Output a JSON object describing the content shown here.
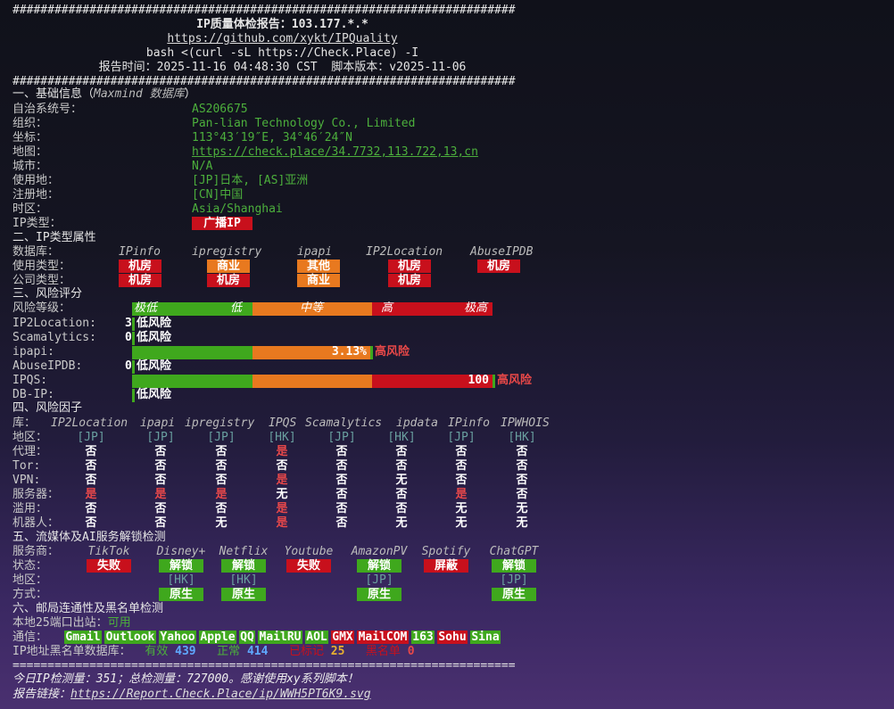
{
  "header": {
    "hash_line": "########################################################################",
    "title": "IP质量体检报告：103.177.*.*",
    "repo_link": "https://github.com/xykt/IPQuality",
    "command": "bash <(curl -sL https://Check.Place) -I",
    "report_time": "报告时间：2025-11-16 04:48:30 CST  脚本版本：v2025-11-06"
  },
  "section1": {
    "title": "一、基础信息（",
    "title_italic": "Maxmind 数据库",
    "title_end": "）",
    "rows": [
      {
        "label": "自治系统号：",
        "value": "AS206675",
        "link": false
      },
      {
        "label": "组织：",
        "value": "Pan-lian Technology Co., Limited",
        "link": false
      },
      {
        "label": "坐标：",
        "value": "113°43′19″E, 34°46′24″N",
        "link": false
      },
      {
        "label": "地图：",
        "value": "https://check.place/34.7732,113.722,13,cn",
        "link": true
      },
      {
        "label": "城市：",
        "value": "N/A",
        "link": false
      },
      {
        "label": "使用地：",
        "value": "[JP]日本, [AS]亚洲",
        "link": false
      },
      {
        "label": "注册地：",
        "value": "[CN]中国",
        "link": false
      },
      {
        "label": "时区：",
        "value": "Asia/Shanghai",
        "link": false
      }
    ],
    "ip_type_label": "IP类型：",
    "ip_type_value": "广播IP"
  },
  "section2": {
    "title": "二、IP类型属性",
    "db_label": "数据库：",
    "dbs": [
      "IPinfo",
      "ipregistry",
      "ipapi",
      "IP2Location",
      "AbuseIPDB"
    ],
    "usage_label": "使用类型：",
    "usage": [
      {
        "text": "机房",
        "color": "red"
      },
      {
        "text": "商业",
        "color": "org"
      },
      {
        "text": "其他",
        "color": "org"
      },
      {
        "text": "机房",
        "color": "red"
      },
      {
        "text": "机房",
        "color": "red"
      }
    ],
    "company_label": "公司类型：",
    "company": [
      {
        "text": "机房",
        "color": "red"
      },
      {
        "text": "机房",
        "color": "red"
      },
      {
        "text": "商业",
        "color": "org"
      },
      {
        "text": "机房",
        "color": "red"
      }
    ]
  },
  "section3": {
    "title": "三、风险评分",
    "level_label": "风险等级：",
    "levels": [
      "极低",
      "低",
      "中等",
      "高",
      "极高"
    ],
    "rows": [
      {
        "label": "IP2Location:",
        "score_text": "3",
        "verdict": "低风险",
        "bar": false,
        "fraction": 0.03
      },
      {
        "label": "Scamalytics:",
        "score_text": "0",
        "verdict": "低风险",
        "bar": false,
        "fraction": 0
      },
      {
        "label": "ipapi:",
        "score_text": "3.13%",
        "verdict": "高风险",
        "bar": true,
        "fraction": 0.66
      },
      {
        "label": "AbuseIPDB:",
        "score_text": "0",
        "verdict": "低风险",
        "bar": false,
        "fraction": 0
      },
      {
        "label": "IPQS:",
        "score_text": "100",
        "verdict": "高风险",
        "bar": true,
        "fraction": 1.0
      },
      {
        "label": "DB-IP:",
        "score_text": "",
        "verdict": "低风险",
        "bar": false,
        "fraction": 0
      }
    ]
  },
  "section4": {
    "title": "四、风险因子",
    "lib_label": "库：",
    "libs": [
      "IP2Location",
      "ipapi",
      "ipregistry",
      "IPQS",
      "Scamalytics",
      "ipdata",
      "IPinfo",
      "IPWHOIS"
    ],
    "rows": [
      {
        "label": "地区：",
        "values": [
          "[JP]",
          "[JP]",
          "[JP]",
          "[HK]",
          "[JP]",
          "[HK]",
          "[JP]",
          "[HK]"
        ]
      },
      {
        "label": "代理：",
        "values": [
          "否",
          "否",
          "否",
          "是",
          "否",
          "否",
          "否",
          "否"
        ]
      },
      {
        "label": "Tor:",
        "values": [
          "否",
          "否",
          "否",
          "否",
          "否",
          "否",
          "否",
          "否"
        ]
      },
      {
        "label": "VPN:",
        "values": [
          "否",
          "否",
          "否",
          "是",
          "否",
          "无",
          "否",
          "否"
        ]
      },
      {
        "label": "服务器：",
        "values": [
          "是",
          "是",
          "是",
          "无",
          "否",
          "否",
          "是",
          "否"
        ]
      },
      {
        "label": "滥用：",
        "values": [
          "否",
          "否",
          "否",
          "是",
          "否",
          "否",
          "无",
          "无"
        ]
      },
      {
        "label": "机器人：",
        "values": [
          "否",
          "否",
          "无",
          "是",
          "否",
          "无",
          "无",
          "无"
        ]
      }
    ]
  },
  "section5": {
    "title": "五、流媒体及AI服务解锁检测",
    "svc_label": "服务商：",
    "services": [
      "TikTok",
      "Disney+",
      "Netflix",
      "Youtube",
      "AmazonPV",
      "Spotify",
      "ChatGPT"
    ],
    "status_label": "状态：",
    "status": [
      {
        "text": "失败",
        "color": "red"
      },
      {
        "text": "解锁",
        "color": "grn"
      },
      {
        "text": "解锁",
        "color": "grn"
      },
      {
        "text": "失败",
        "color": "red"
      },
      {
        "text": "解锁",
        "color": "grn"
      },
      {
        "text": "屏蔽",
        "color": "red"
      },
      {
        "text": "解锁",
        "color": "grn"
      }
    ],
    "region_label": "地区：",
    "regions": [
      "",
      "[HK]",
      "[HK]",
      "",
      "[JP]",
      "",
      "[JP]"
    ],
    "method_label": "方式：",
    "methods": [
      "",
      "原生",
      "原生",
      "",
      "原生",
      "",
      "原生"
    ]
  },
  "section6": {
    "title": "六、邮局连通性及黑名单检测",
    "port25_label": "本地25端口出站：",
    "port25_value": "可用",
    "comm_label": "通信：",
    "mail": [
      {
        "name": "Gmail",
        "ok": true
      },
      {
        "name": "Outlook",
        "ok": true
      },
      {
        "name": "Yahoo",
        "ok": true
      },
      {
        "name": "Apple",
        "ok": true
      },
      {
        "name": "QQ",
        "ok": true
      },
      {
        "name": "MailRU",
        "ok": true
      },
      {
        "name": "AOL",
        "ok": true
      },
      {
        "name": "GMX",
        "ok": false
      },
      {
        "name": "MailCOM",
        "ok": false
      },
      {
        "name": "163",
        "ok": true
      },
      {
        "name": "Sohu",
        "ok": false
      },
      {
        "name": "Sina",
        "ok": true
      }
    ],
    "blacklist_label": "IP地址黑名单数据库：",
    "valid_label": "有效",
    "valid_value": "439",
    "normal_label": "正常",
    "normal_value": "414",
    "marked_label": "已标记",
    "marked_value": "25",
    "black_label": "黑名单",
    "black_value": "0"
  },
  "footer": {
    "eq_line": "========================================================================",
    "stats": "今日IP检测量：351；总检测量：727000。感谢使用xy系列脚本！",
    "report_label": "报告链接：",
    "report_link": "https://Report.Check.Place/ip/WWH5PT6K9.svg"
  }
}
